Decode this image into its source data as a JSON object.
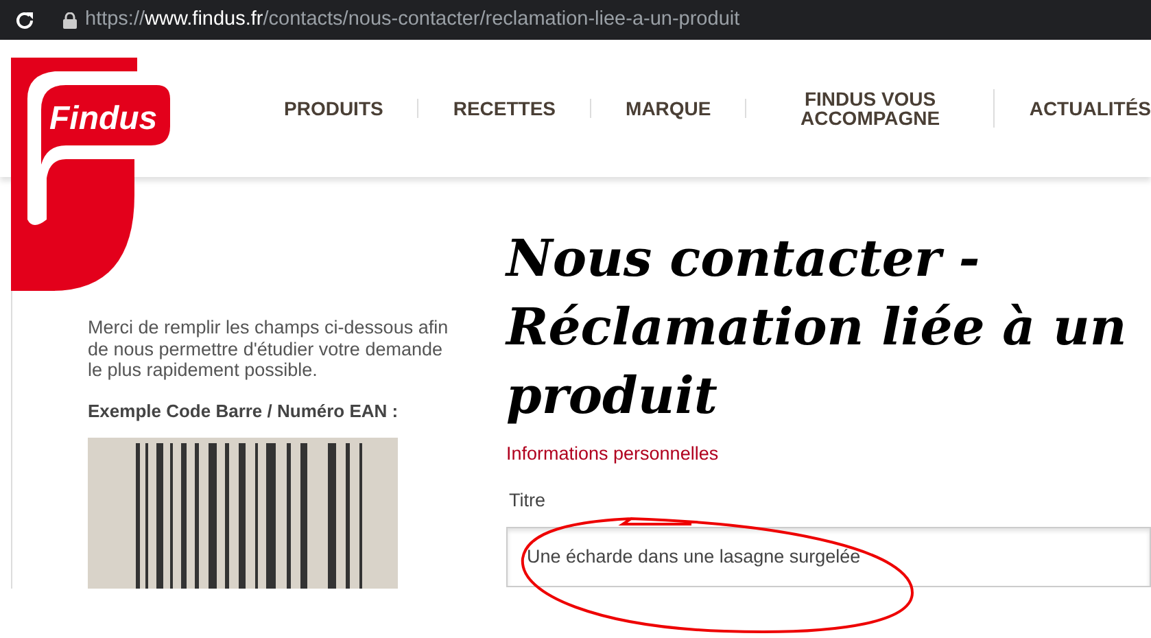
{
  "browser": {
    "url_scheme": "https://",
    "url_host": "www.findus.fr",
    "url_path": "/contacts/nous-contacter/reclamation-liee-a-un-produit"
  },
  "logo": {
    "text": "Findus"
  },
  "nav": [
    {
      "label": "PRODUITS"
    },
    {
      "label": "RECETTES"
    },
    {
      "label": "MARQUE"
    },
    {
      "label": "FINDUS VOUS ACCOMPAGNE"
    },
    {
      "label": "ACTUALITÉS"
    }
  ],
  "sidebar": {
    "intro": "Merci de remplir les champs ci-dessous afin de nous permettre d'étudier votre demande le plus rapidement possible.",
    "barcode_label": "Exemple Code Barre / Numéro EAN :"
  },
  "main": {
    "title": "Nous contacter - Réclamation liée à un produit",
    "section_heading": "Informations personnelles",
    "field": {
      "label": "Titre",
      "value": "Une écharde dans une lasagne surgelée"
    }
  }
}
